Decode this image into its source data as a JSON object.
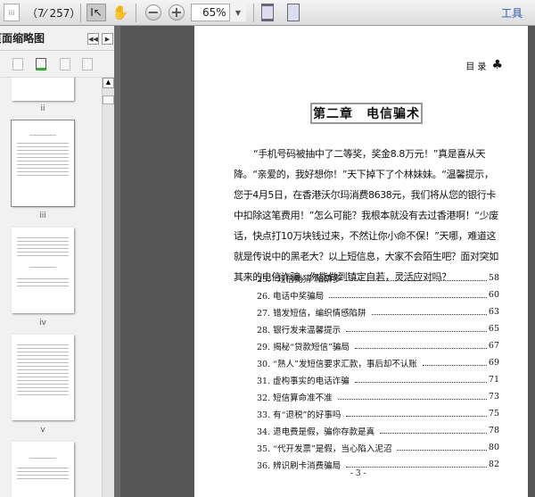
{
  "toolbar": {
    "page_input": "iii",
    "page_count": "（7⁄ 257）",
    "zoom": "65%",
    "tools_label": "工具"
  },
  "sidebar": {
    "title": "页面缩略图",
    "thumbnail_labels": [
      "ii",
      "iii",
      "iv",
      "v"
    ]
  },
  "page": {
    "header": "目 录",
    "chapter_title": "第二章　电信骗术",
    "intro": "“手机号码被抽中了二等奖，奖金8.8万元！”真是喜从天降。“亲爱的，我好想你！”天下掉下了个林妹妹。“温馨提示，您于4月5日，在香港沃尔玛消费8638元，我们将从您的银行卡中扣除这笔费用！”怎么可能？我根本就没有去过香港啊！“少废话，快点打10万块钱过来，不然让你小命不保！”天哪，难道这就是传说中的黑老大？以上短信息，大家不会陌生吧？面对突如其来的电信诈骗，你能做到镇定自若，灵活应对吗？",
    "toc": [
      {
        "title": "25. “短信竞猜”陷阱多",
        "page": "58"
      },
      {
        "title": "26. 电话中奖骗局",
        "page": "60"
      },
      {
        "title": "27. 错发短信，编织情感陷阱",
        "page": "63"
      },
      {
        "title": "28. 银行发来温馨提示",
        "page": "65"
      },
      {
        "title": "29. 揭秘“贷款短信”骗局",
        "page": "67"
      },
      {
        "title": "30. “熟人”发短信要求汇款，事后却不认账",
        "page": "69"
      },
      {
        "title": "31. 虚构事实的电话诈骗",
        "page": "71"
      },
      {
        "title": "32. 短信算命准不准",
        "page": "73"
      },
      {
        "title": "33. 有“退税”的好事吗",
        "page": "75"
      },
      {
        "title": "34. 退电费是假，骗你存款是真",
        "page": "78"
      },
      {
        "title": "35. “代开发票”是假，当心陷入泥沼",
        "page": "80"
      },
      {
        "title": "36. 辨识刷卡消费骗局",
        "page": "82"
      }
    ],
    "page_number": "- 3 -"
  }
}
